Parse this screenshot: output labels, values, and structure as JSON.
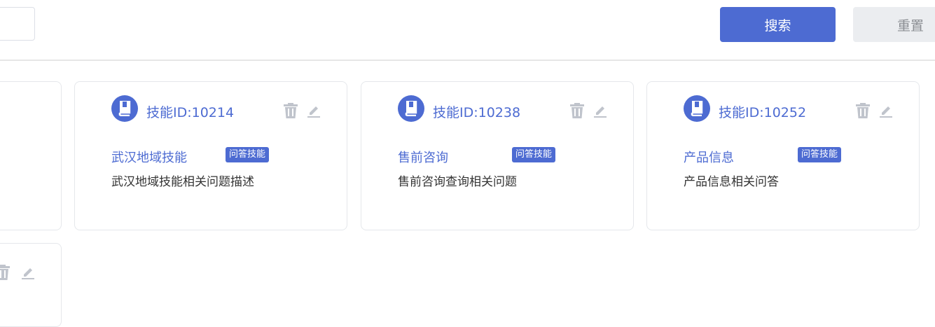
{
  "toolbar": {
    "search_label": "搜索",
    "reset_label": "重置"
  },
  "cards": [
    {
      "id_text": "技能ID:10214",
      "title": "武汉地域技能",
      "badge": "问答技能",
      "description": "武汉地域技能相关问题描述"
    },
    {
      "id_text": "技能ID:10238",
      "title": "售前咨询",
      "badge": "问答技能",
      "description": "售前咨询查询相关问题"
    },
    {
      "id_text": "技能ID:10252",
      "title": "产品信息",
      "badge": "问答技能",
      "description": "产品信息相关问答"
    }
  ],
  "colors": {
    "accent": "#4d6bd2",
    "icon_gray": "#c0c4cc",
    "reset_bg": "#ebedf0"
  },
  "icons": [
    "book-icon",
    "trash-icon",
    "edit-icon"
  ]
}
